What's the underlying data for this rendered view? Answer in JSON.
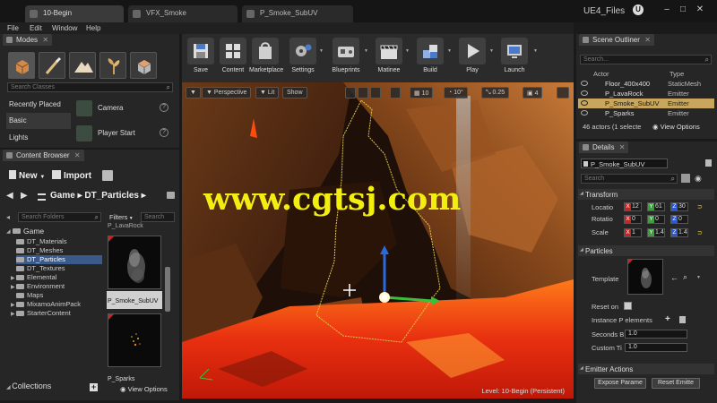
{
  "window": {
    "tabs": [
      {
        "label": "10-Begin"
      },
      {
        "label": "VFX_Smoke"
      },
      {
        "label": "P_Smoke_SubUV"
      }
    ],
    "project_title": "UE4_Files"
  },
  "menu": {
    "items": [
      "File",
      "Edit",
      "Window",
      "Help"
    ]
  },
  "modes": {
    "tab_label": "Modes",
    "search_placeholder": "Search Classes",
    "categories": [
      "Recently Placed",
      "Basic",
      "Lights"
    ],
    "items": [
      "Camera",
      "Player Start"
    ]
  },
  "content_browser": {
    "tab_label": "Content Browser",
    "new_label": "New",
    "import_label": "Import",
    "path_root": "Game",
    "path_folder": "DT_Particles",
    "search_folders_placeholder": "Search Folders",
    "filters_label": "Filters",
    "search_placeholder": "Search",
    "tree": {
      "root": "Game",
      "folders": [
        "DT_Materials",
        "DT_Meshes",
        "DT_Particles",
        "DT_Textures",
        "Elemental",
        "Environment",
        "Maps",
        "MixamoAnimPack",
        "StarterContent"
      ]
    },
    "assets": [
      "P_LavaRock",
      "P_Smoke_SubUV",
      "P_Sparks"
    ],
    "collections_label": "Collections",
    "view_options_label": "View Options"
  },
  "toolbar": {
    "items": [
      "Save",
      "Content",
      "Marketplace",
      "Settings",
      "Blueprints",
      "Matinee",
      "Build",
      "Play",
      "Launch"
    ]
  },
  "viewport": {
    "perspective_label": "Perspective",
    "lit_label": "Lit",
    "show_label": "Show",
    "grid_value": "10",
    "angle_value": "10°",
    "scale_value": "0.25",
    "camera_speed": "4",
    "watermark": "www.cgtsj.com",
    "level_label": "Level: 10-Begin (Persistent)"
  },
  "outliner": {
    "tab_label": "Scene Outliner",
    "search_placeholder": "Search...",
    "col_actor": "Actor",
    "col_type": "Type",
    "rows": [
      {
        "name": "Floor_400x400",
        "type": "StaticMesh"
      },
      {
        "name": "P_LavaRock",
        "type": "Emitter"
      },
      {
        "name": "P_Smoke_SubUV",
        "type": "Emitter"
      },
      {
        "name": "P_Sparks",
        "type": "Emitter"
      }
    ],
    "count_label": "46 actors (1 selecte",
    "view_options_label": "View Options"
  },
  "details": {
    "tab_label": "Details",
    "actor_name": "P_Smoke_SubUV",
    "search_placeholder": "Search",
    "transform_label": "Transform",
    "location_label": "Locatio",
    "rotation_label": "Rotatio",
    "scale_label": "Scale",
    "location": {
      "x": "12",
      "y": "61",
      "z": "30"
    },
    "rotation": {
      "x": "0",
      "y": "0",
      "z": "0"
    },
    "scale": {
      "x": "1",
      "y": "1.4",
      "z": "1.4"
    },
    "particles_label": "Particles",
    "template_label": "Template",
    "reset_on_label": "Reset on",
    "instance_params_label": "Instance P elements",
    "seconds_label": "Seconds B",
    "seconds_value": "1.0",
    "custom_label": "Custom Ti",
    "custom_value": "1.0",
    "emitter_actions_label": "Emitter Actions",
    "expose_params_label": "Expose Parame",
    "reset_emitter_label": "Reset Emitte"
  }
}
